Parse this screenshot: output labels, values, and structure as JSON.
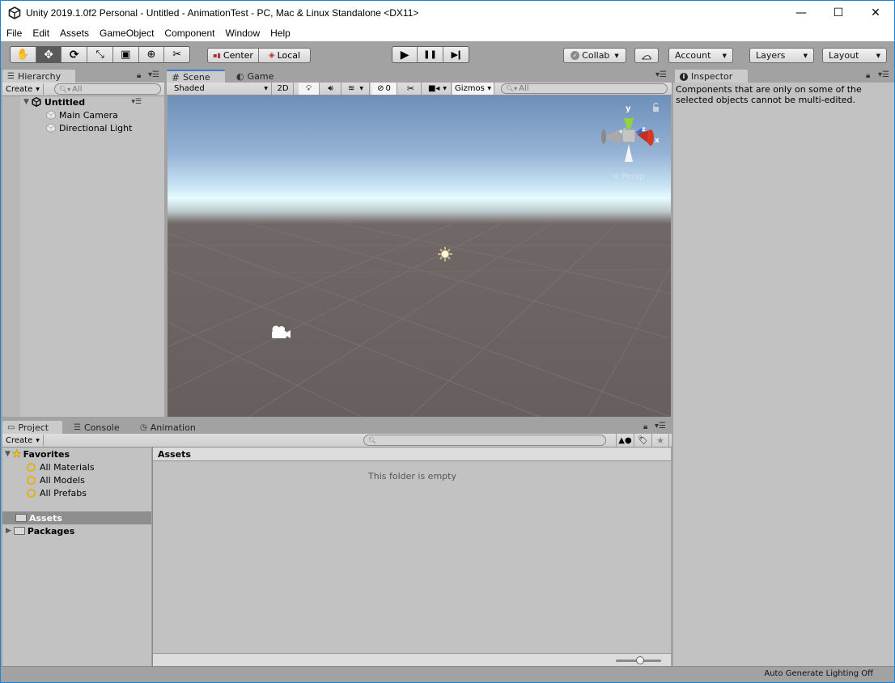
{
  "window": {
    "title": "Unity 2019.1.0f2 Personal - Untitled - AnimationTest - PC, Mac & Linux Standalone <DX11>",
    "controls": {
      "minimize": "—",
      "maximize": "☐",
      "close": "✕"
    }
  },
  "menubar": {
    "items": [
      "File",
      "Edit",
      "Assets",
      "GameObject",
      "Component",
      "Window",
      "Help"
    ]
  },
  "toolbar": {
    "tools": [
      {
        "name": "hand-tool",
        "icon": "✋",
        "active": false
      },
      {
        "name": "move-tool",
        "icon": "✥",
        "active": true
      },
      {
        "name": "rotate-tool",
        "icon": "⟳",
        "active": false
      },
      {
        "name": "scale-tool",
        "icon": "⤡",
        "active": false
      },
      {
        "name": "rect-tool",
        "icon": "▣",
        "active": false
      },
      {
        "name": "transform-tool",
        "icon": "⊕",
        "active": false
      },
      {
        "name": "custom-tool",
        "icon": "✂",
        "active": false
      }
    ],
    "pivot_label": "Center",
    "space_label": "Local",
    "play_icon": "▶",
    "pause_icon": "❚❚",
    "step_icon": "▶❙",
    "collab_label": "Collab",
    "cloud_icon": "☁",
    "account_label": "Account",
    "layers_label": "Layers",
    "layout_label": "Layout"
  },
  "hierarchy": {
    "tab_label": "Hierarchy",
    "create_label": "Create",
    "search_placeholder": "All",
    "scene_name": "Untitled",
    "items": [
      "Main Camera",
      "Directional Light"
    ]
  },
  "scene_view": {
    "tabs": [
      {
        "label": "Scene",
        "icon": "#"
      },
      {
        "label": "Game",
        "icon": "◐"
      }
    ],
    "shading_mode": "Shaded",
    "mode_2d_label": "2D",
    "hidden_count": "0",
    "gizmos_label": "Gizmos",
    "search_placeholder": "All",
    "projection_label": "Persp",
    "axis_labels": {
      "x": "x",
      "y": "y",
      "z": "z"
    }
  },
  "inspector": {
    "tab_label": "Inspector",
    "message": "Components that are only on some of the selected objects cannot be multi-edited."
  },
  "bottom_panel": {
    "tabs": [
      {
        "label": "Project",
        "icon": "▭"
      },
      {
        "label": "Console",
        "icon": "☰"
      },
      {
        "label": "Animation",
        "icon": "◷"
      }
    ],
    "create_label": "Create",
    "favorites": {
      "label": "Favorites",
      "items": [
        "All Materials",
        "All Models",
        "All Prefabs"
      ]
    },
    "folders": [
      {
        "label": "Assets",
        "selected": true
      },
      {
        "label": "Packages",
        "selected": false
      }
    ],
    "breadcrumb": "Assets",
    "empty_message": "This folder is empty",
    "zoom_slider_value": 0.5
  },
  "status": {
    "message": "Auto Generate Lighting Off"
  },
  "colors": {
    "accent": "#3a7bd5",
    "window_border": "#1883d7",
    "panel_bg": "#c2c2c2",
    "chrome_bg": "#a2a2a2",
    "selection": "#8e8e8e"
  }
}
